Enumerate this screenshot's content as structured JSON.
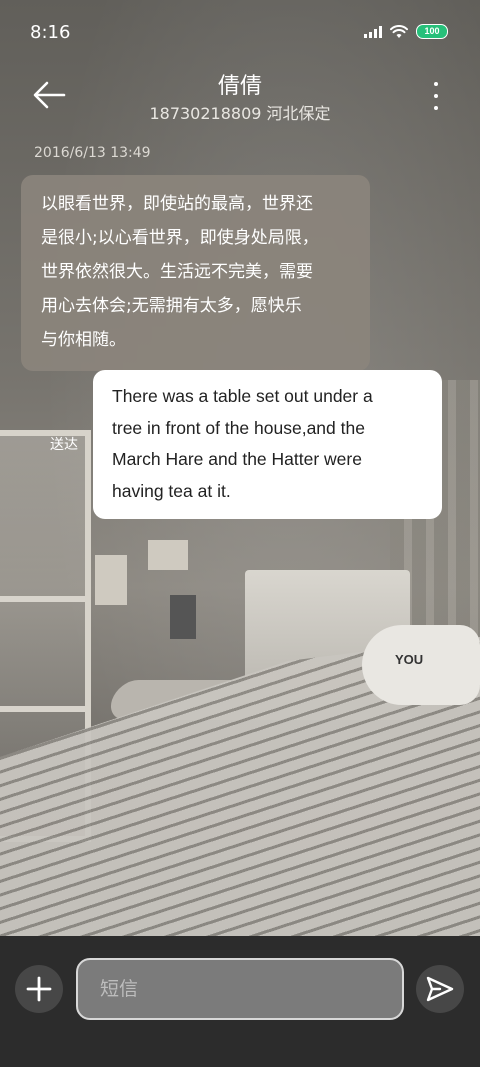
{
  "status_bar": {
    "time": "8:16",
    "battery": "100",
    "icons": [
      "signal-icon",
      "wifi-icon",
      "battery-icon"
    ]
  },
  "header": {
    "contact_name": "倩倩",
    "contact_subtitle": "18730218809 河北保定",
    "icons": [
      "back-arrow-icon",
      "more-vertical-icon"
    ]
  },
  "conversation": {
    "timestamp": "2016/6/13 13:49",
    "messages": [
      {
        "direction": "incoming",
        "lines": [
          "以眼看世界，即使站的最高，世界还",
          "是很小;以心看世界，即使身处局限，",
          "世界依然很大。生活远不完美，需要",
          "用心去体会;无需拥有太多，愿快乐",
          "与你相随。"
        ]
      },
      {
        "direction": "outgoing",
        "lines": [
          "There was a table set out under a",
          "tree in front of the house,and the",
          "March Hare and the Hatter were",
          "having tea at it."
        ],
        "status": "送达"
      }
    ]
  },
  "background_photo": {
    "pillow_text": "YOU"
  },
  "composer": {
    "placeholder": "短信",
    "icons": [
      "plus-icon",
      "send-icon"
    ]
  },
  "colors": {
    "incoming_bubble": "#8b847c",
    "outgoing_bubble": "#ffffff",
    "bottom_bar": "#2c2c2c",
    "battery": "#27c07a"
  }
}
